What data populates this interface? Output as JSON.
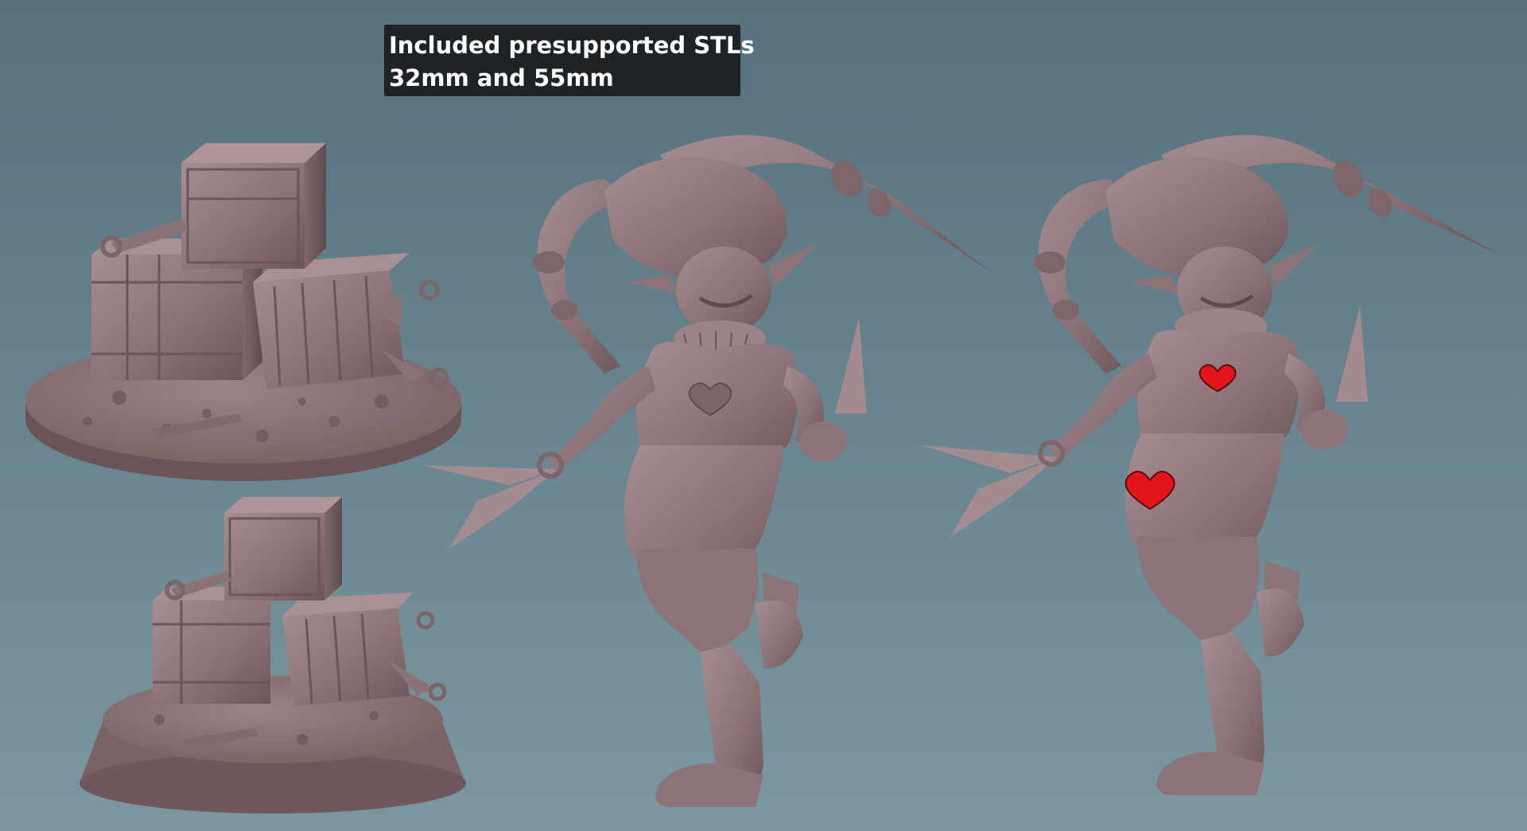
{
  "caption": {
    "line1": "Included presupported STLs",
    "line2": "32mm and 55mm"
  },
  "scene": {
    "model_color": "#8d7478",
    "model_shadow": "#6b5558",
    "model_highlight": "#a99095",
    "heart_color": "#e3141a",
    "bases": [
      {
        "name": "32mm",
        "type": "flat-base-crates"
      },
      {
        "name": "55mm",
        "type": "tall-base-crates"
      }
    ],
    "figures": [
      {
        "name": "jester-nsfw-view",
        "censor": false
      },
      {
        "name": "jester-censored-view",
        "censor": true
      }
    ]
  }
}
